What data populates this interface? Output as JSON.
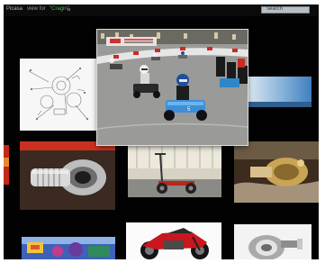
{
  "toolbar": {
    "app_title": "Picasa",
    "search_label": "view for",
    "search_query": "\"Cragin\"",
    "search_box_label": "search"
  },
  "photos": {
    "zoomed": "go-kart race",
    "grid": [
      "diagram sketch",
      "sky panorama",
      "red edge photo",
      "chrome exhaust part",
      "red scooter",
      "brass engine part",
      "colorful poster",
      "red motorcycle",
      "metal part"
    ]
  },
  "colors": {
    "background": "#020202",
    "query": "#5fae5a"
  }
}
